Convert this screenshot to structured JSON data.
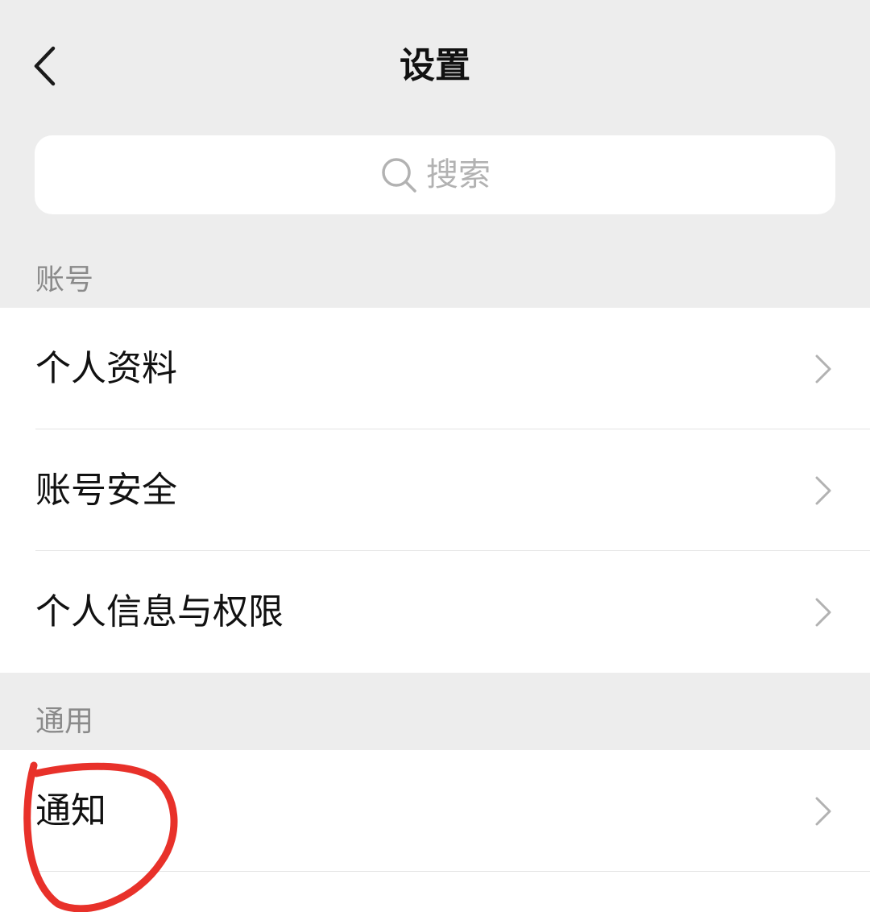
{
  "nav": {
    "title": "设置",
    "back_icon": "chevron-left-icon"
  },
  "search": {
    "placeholder": "搜索",
    "icon": "search-icon"
  },
  "sections": [
    {
      "header": "账号",
      "items": [
        {
          "label": "个人资料",
          "icon": "chevron-right-icon"
        },
        {
          "label": "账号安全",
          "icon": "chevron-right-icon"
        },
        {
          "label": "个人信息与权限",
          "icon": "chevron-right-icon"
        }
      ]
    },
    {
      "header": "通用",
      "items": [
        {
          "label": "通知",
          "icon": "chevron-right-icon"
        }
      ]
    }
  ],
  "colors": {
    "background": "#ededed",
    "card": "#ffffff",
    "text": "#111111",
    "secondary_text": "#8a8a8a",
    "placeholder": "#b2b2b2",
    "chevron": "#b2b2b2",
    "annotation": "#e8312a"
  }
}
